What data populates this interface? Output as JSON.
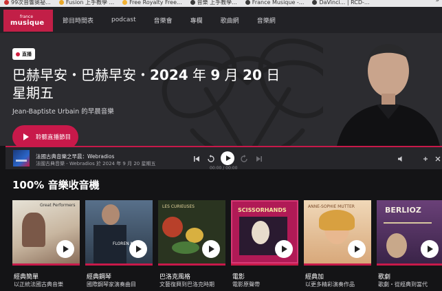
{
  "bookmarks": [
    {
      "label": "99次音響奧祕...",
      "color": "#c33"
    },
    {
      "label": "Fusion 上手教學 ...",
      "color": "#e9a82a"
    },
    {
      "label": "Free Royalty Free...",
      "color": "#f2b233"
    },
    {
      "label": "音樂 上手教學...",
      "color": "#3a3a3a"
    },
    {
      "label": "France Musique -...",
      "color": "#3a3a3a"
    },
    {
      "label": "DaVinci... | RCD-...",
      "color": "#3a3a3a"
    }
  ],
  "bookmarks_more": "»",
  "header": {
    "logo_top": "france",
    "logo_main": "musique",
    "nav": [
      "節目時間表",
      "podcast",
      "音樂會",
      "專欄",
      "歌曲網",
      "音樂網"
    ]
  },
  "hero": {
    "badge": "直播",
    "title_part1": "巴赫早安・巴赫早安・",
    "title_bold1": "2024",
    "title_part2": " 年 ",
    "title_bold2": "9",
    "title_part3": " 月 ",
    "title_bold3": "20",
    "title_part4": " 日",
    "title_line2": "星期五",
    "subtitle": "Jean-Baptiste Urbain 的早晨音樂",
    "listen_label": "聆聽直播節目"
  },
  "player": {
    "line1": "法國古典音樂之早晨：Webradios",
    "line2": "法國古典音樂 - Webradios 於 2024 年 9 月 20 星期五",
    "time": "00:00 / 00:00"
  },
  "section": {
    "title_bold": "100%",
    "title_rest": " 音樂收音機"
  },
  "cards": [
    {
      "name": "經典簡單",
      "desc": "以正統法國古典音樂",
      "cover_text": "Great Performers",
      "bg": "#d8d4c8"
    },
    {
      "name": "經典鋼琴",
      "desc": "國際鋼琴家演奏曲目",
      "cover_text": "FLOREN MARK",
      "bg": "#3a4a5a"
    },
    {
      "name": "巴洛克風格",
      "desc": "文藝復興到巴洛克時期",
      "cover_text": "LES CURIEUSES",
      "bg": "#2c3a22"
    },
    {
      "name": "電影",
      "desc": "電影原聲帶",
      "cover_text": "SCISSORHANDS",
      "bg": "#b01a56"
    },
    {
      "name": "經典加",
      "desc": "以更多精彩演奏作品",
      "cover_text": "ANNE-SOPHIE MUTTER",
      "bg": "#e8c8a0"
    },
    {
      "name": "歌劇",
      "desc": "歌劇・從經典到當代",
      "cover_text": "BERLIOZ",
      "bg": "#5a3468"
    }
  ]
}
